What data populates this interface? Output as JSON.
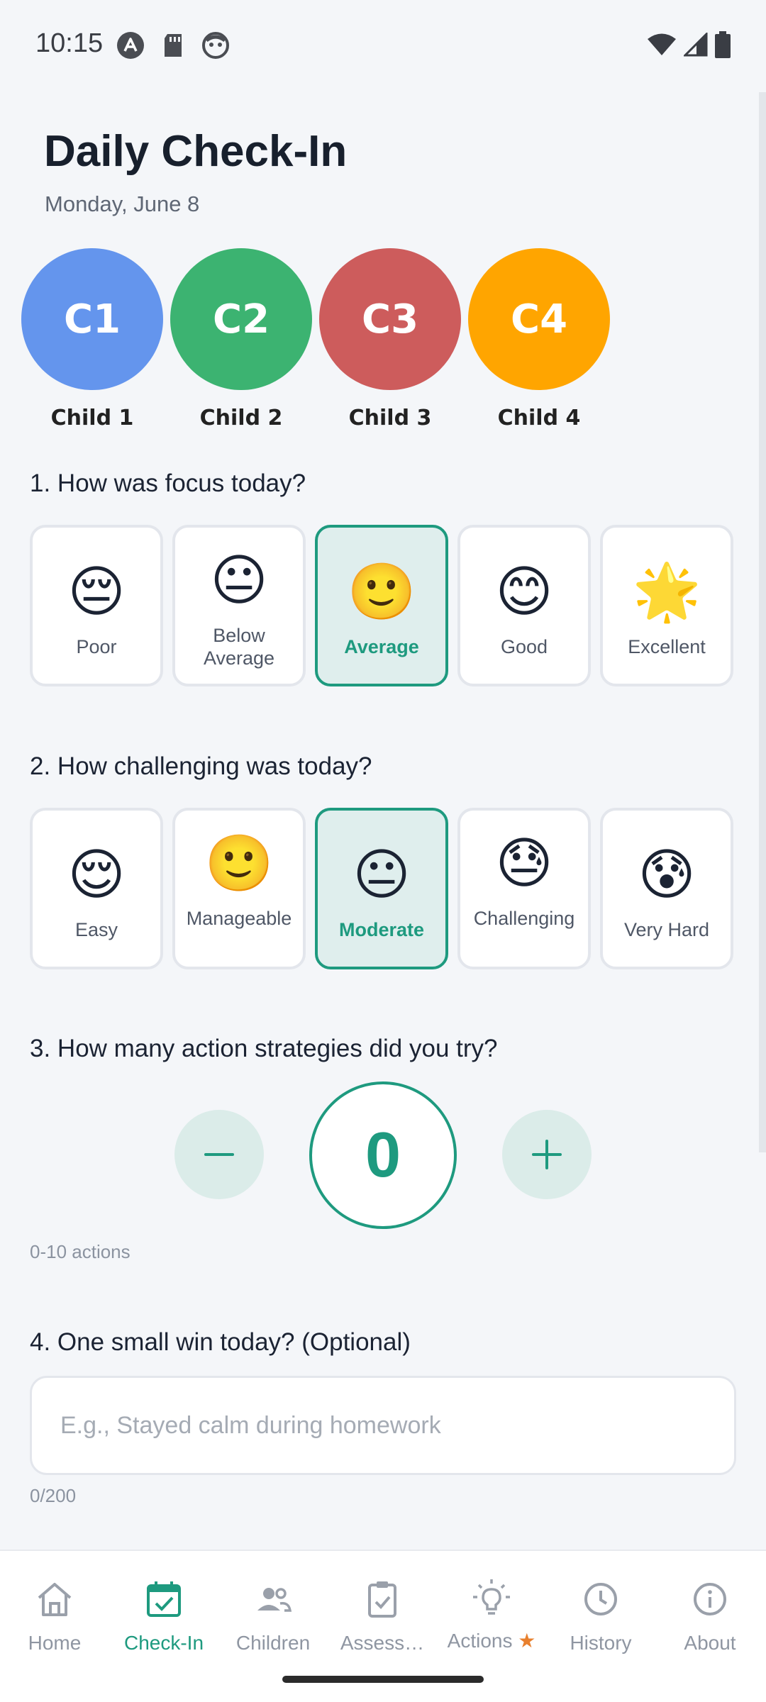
{
  "status_bar": {
    "time": "10:15",
    "icons_left": [
      "app-icon",
      "sd-card-icon",
      "face-icon"
    ],
    "icons_right": [
      "wifi-icon",
      "signal-icon",
      "battery-icon"
    ]
  },
  "header": {
    "title": "Daily Check-In",
    "date": "Monday, June 8"
  },
  "children": [
    {
      "initials": "C1",
      "name": "Child 1",
      "color": "#6495ed"
    },
    {
      "initials": "C2",
      "name": "Child 2",
      "color": "#3cb371"
    },
    {
      "initials": "C3",
      "name": "Child 3",
      "color": "#cd5c5c"
    },
    {
      "initials": "C4",
      "name": "Child 4",
      "color": "#ffa500"
    }
  ],
  "questions": {
    "focus": {
      "title": "1. How was focus today?",
      "selected": "Average",
      "options": [
        {
          "emoji": "😔",
          "label": "Poor"
        },
        {
          "emoji": "😐",
          "label": "Below Average"
        },
        {
          "emoji": "🙂",
          "label": "Average"
        },
        {
          "emoji": "😊",
          "label": "Good"
        },
        {
          "emoji": "🌟",
          "label": "Excellent"
        }
      ]
    },
    "challenge": {
      "title": "2. How challenging was today?",
      "selected": "Moderate",
      "options": [
        {
          "emoji": "😌",
          "label": "Easy"
        },
        {
          "emoji": "🙂",
          "label": "Manageable"
        },
        {
          "emoji": "😐",
          "label": "Moderate"
        },
        {
          "emoji": "😓",
          "label": "Challenging"
        },
        {
          "emoji": "😰",
          "label": "Very Hard"
        }
      ]
    },
    "actions": {
      "title": "3. How many action strategies did you try?",
      "value": "0",
      "hint": "0-10 actions"
    },
    "win": {
      "title": "4. One small win today? (Optional)",
      "placeholder": "E.g., Stayed calm during homework",
      "value": "",
      "counter": "0/200"
    }
  },
  "bottom_nav": {
    "active": "Check-In",
    "items": [
      {
        "label": "Home",
        "icon": "home-icon"
      },
      {
        "label": "Check-In",
        "icon": "calendar-check-icon"
      },
      {
        "label": "Children",
        "icon": "people-icon"
      },
      {
        "label": "Assess…",
        "icon": "clipboard-check-icon"
      },
      {
        "label": "Actions",
        "icon": "lightbulb-icon",
        "badge": "★"
      },
      {
        "label": "History",
        "icon": "clock-icon"
      },
      {
        "label": "About",
        "icon": "info-icon"
      }
    ]
  },
  "colors": {
    "accent": "#1e9a7f",
    "background": "#f4f6f9",
    "selected_bg": "#dfeeed"
  }
}
